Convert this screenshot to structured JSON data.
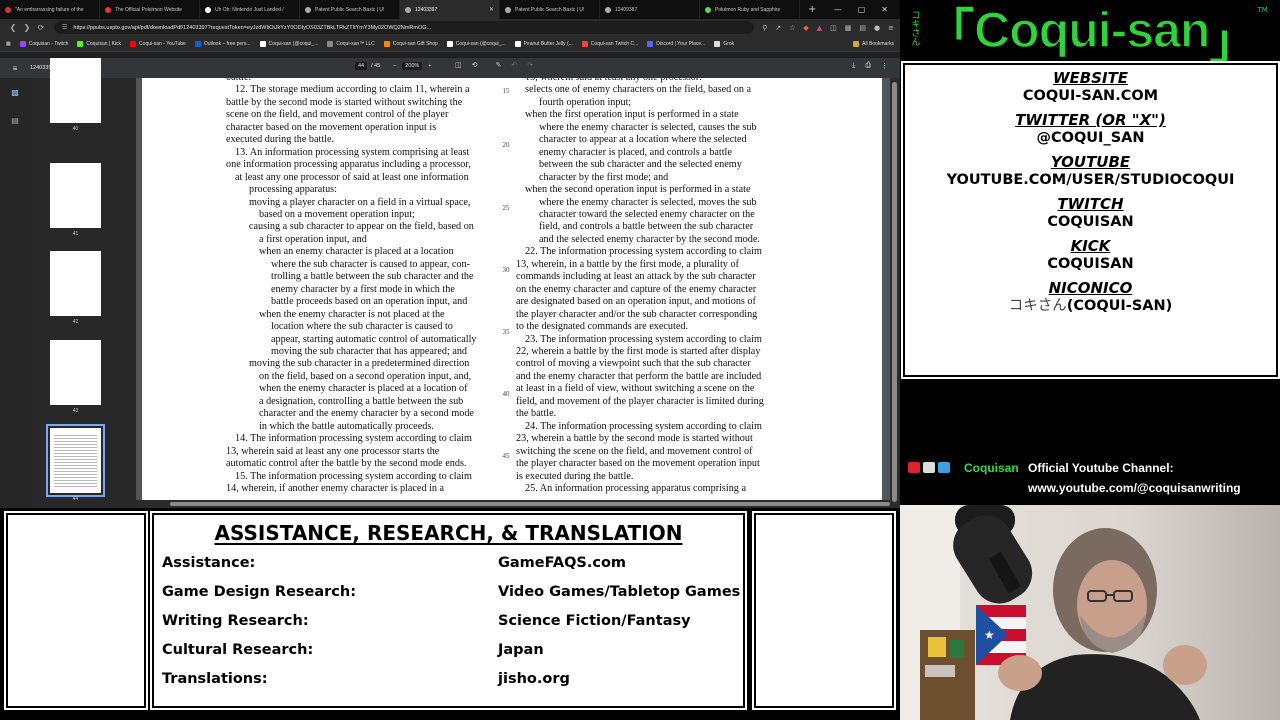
{
  "browser": {
    "tabs": [
      {
        "label": "\"An embarrassing failure of the",
        "color": "#d33"
      },
      {
        "label": "The Official Pokémon Website",
        "color": "#e33"
      },
      {
        "label": "Uh Oh: Nintendo Just Landed /",
        "color": "#fff"
      },
      {
        "label": "Patent Public Search Basic | U!",
        "color": "#aaa"
      },
      {
        "label": "12403397",
        "color": "#aaa",
        "active": true
      },
      {
        "label": "Patent Public Search Basic | U!",
        "color": "#aaa"
      },
      {
        "label": "12409387",
        "color": "#aaa"
      },
      {
        "label": "Pokémon Ruby and Sapphire",
        "color": "#6c6"
      }
    ],
    "url": "https://ppubs.uspto.gov/api/pdf/downloadPdf/12403397?requestToken=eyJzdWIiOiJkYzY0ODIyOS03ZTBkLTRkZTItYmY3My02OWQ2NmRmOG...",
    "bookmarks": [
      {
        "label": "Coquisan - Twitch",
        "color": "#9146ff"
      },
      {
        "label": "Coquisan | Kick",
        "color": "#53fc18"
      },
      {
        "label": "Coqui-san - YouTube",
        "color": "#f00"
      },
      {
        "label": "Outlook – free pers...",
        "color": "#0a64d8"
      },
      {
        "label": "Coqui-san (@coqui_...",
        "color": "#fff"
      },
      {
        "label": "Coqui-san™ LLC",
        "color": "#888"
      },
      {
        "label": "Coqui-san Gift Shop",
        "color": "#f80"
      },
      {
        "label": "Coqui-san (@coqui_...",
        "color": "#fff"
      },
      {
        "label": "Peanut Butter Jelly (...",
        "color": "#fff"
      },
      {
        "label": "Coqui-san Twitch C...",
        "color": "#e44"
      },
      {
        "label": "Discord | Your Place...",
        "color": "#5865f2"
      },
      {
        "label": "Grok",
        "color": "#ddd"
      }
    ],
    "all_bookmarks": "All Bookmarks"
  },
  "pdf": {
    "title": "12403397",
    "page_current": "44",
    "page_total": "/ 45",
    "zoom": "200%",
    "thumbnails": [
      "40",
      "41",
      "42",
      "43",
      "44"
    ],
    "left_column": [
      {
        "t": "battle.",
        "c": ""
      },
      {
        "t": "12. The storage medium according to claim 11, wherein a",
        "c": "i1"
      },
      {
        "t": "battle by the second mode is started without switching the",
        "c": ""
      },
      {
        "t": "scene on the field, and movement control of the player",
        "c": ""
      },
      {
        "t": "character based on the movement operation input is",
        "c": ""
      },
      {
        "t": "executed during the battle.",
        "c": ""
      },
      {
        "t": "13. An information processing system comprising at least",
        "c": "i1"
      },
      {
        "t": "one information processing apparatus including a processor,",
        "c": ""
      },
      {
        "t": "at least any one processor of said at least one information",
        "c": "i1"
      },
      {
        "t": "processing apparatus:",
        "c": "i3"
      },
      {
        "t": "moving a player character on a field in a virtual space,",
        "c": "i3"
      },
      {
        "t": "based on a movement operation input;",
        "c": "i4"
      },
      {
        "t": "causing a sub character to appear on the field, based on",
        "c": "i3"
      },
      {
        "t": "a first operation input, and",
        "c": "i4"
      },
      {
        "t": "when an enemy character is placed at a location",
        "c": "i4"
      },
      {
        "t": "where the sub character is caused to appear, con-",
        "c": "i5"
      },
      {
        "t": "trolling a battle between the sub character and the",
        "c": "i5"
      },
      {
        "t": "enemy character by a first mode in which the",
        "c": "i5"
      },
      {
        "t": "battle proceeds based on an operation input, and",
        "c": "i5"
      },
      {
        "t": "when the enemy character is not placed at the",
        "c": "i4"
      },
      {
        "t": "location where the sub character is caused to",
        "c": "i5"
      },
      {
        "t": "appear, starting automatic control of automatically",
        "c": "i5"
      },
      {
        "t": "moving the sub character that has appeared; and",
        "c": "i5"
      },
      {
        "t": "moving the sub character in a predetermined direction",
        "c": "i3"
      },
      {
        "t": "on the field, based on a second operation input, and,",
        "c": "i4"
      },
      {
        "t": "when the enemy character is placed at a location of",
        "c": "i4"
      },
      {
        "t": "a designation, controlling a battle between the sub",
        "c": "i4"
      },
      {
        "t": "character and the enemy character by a second mode",
        "c": "i4"
      },
      {
        "t": "in which the battle automatically proceeds.",
        "c": "i4"
      },
      {
        "t": "14. The information processing system according to claim",
        "c": "i1"
      },
      {
        "t": "13, wherein said at least any one processor starts the",
        "c": ""
      },
      {
        "t": "automatic control after the battle by the second mode ends.",
        "c": ""
      },
      {
        "t": "15. The information processing system according to claim",
        "c": "i1"
      },
      {
        "t": "14, wherein, if another enemy character is placed in a",
        "c": ""
      }
    ],
    "right_column": [
      {
        "t": "13, wherein said at least any one processor:",
        "c": "i1"
      },
      {
        "t": "selects one of enemy characters on the field, based on a",
        "c": "i1"
      },
      {
        "t": "fourth operation input;",
        "c": "i3"
      },
      {
        "t": "when the first operation input is performed in a state",
        "c": "i1"
      },
      {
        "t": "where the enemy character is selected, causes the sub",
        "c": "i3"
      },
      {
        "t": "character to appear at a location where the selected",
        "c": "i3"
      },
      {
        "t": "enemy character is placed, and controls a battle",
        "c": "i3"
      },
      {
        "t": "between the sub character and the selected enemy",
        "c": "i3"
      },
      {
        "t": "character by the first mode; and",
        "c": "i3"
      },
      {
        "t": "when the second operation input is performed in a state",
        "c": "i1"
      },
      {
        "t": "where the enemy character is selected, moves the sub",
        "c": "i3"
      },
      {
        "t": "character toward the selected enemy character on the",
        "c": "i3"
      },
      {
        "t": "field, and controls a battle between the sub character",
        "c": "i3"
      },
      {
        "t": "and the selected enemy character by the second mode.",
        "c": "i3"
      },
      {
        "t": "22. The information processing system according to claim",
        "c": "i1"
      },
      {
        "t": "13, wherein, in a battle by the first mode, a plurality of",
        "c": ""
      },
      {
        "t": "commands including at least an attack by the sub character",
        "c": ""
      },
      {
        "t": "on the enemy character and capture of the enemy character",
        "c": ""
      },
      {
        "t": "are designated based on an operation input, and motions of",
        "c": ""
      },
      {
        "t": "the player character and/or the sub character corresponding",
        "c": ""
      },
      {
        "t": "to the designated commands are executed.",
        "c": ""
      },
      {
        "t": "23. The information processing system according to claim",
        "c": "i1"
      },
      {
        "t": "22, wherein a battle by the first mode is started after display",
        "c": ""
      },
      {
        "t": "control of moving a viewpoint such that the sub character",
        "c": ""
      },
      {
        "t": "and the enemy character that perform the battle are included",
        "c": ""
      },
      {
        "t": "at least in a field of view, without switching a scene on the",
        "c": ""
      },
      {
        "t": "field, and movement of the player character is limited during",
        "c": ""
      },
      {
        "t": "the battle.",
        "c": ""
      },
      {
        "t": "24. The information processing system according to claim",
        "c": "i1"
      },
      {
        "t": "23, wherein a battle by the second mode is started without",
        "c": ""
      },
      {
        "t": "switching the scene on the field, and movement control of",
        "c": ""
      },
      {
        "t": "the player character based on the movement operation input",
        "c": ""
      },
      {
        "t": "is executed during the battle.",
        "c": ""
      },
      {
        "t": "25. An information processing apparatus comprising a",
        "c": "i1"
      }
    ],
    "line_numbers": [
      "15",
      "20",
      "25",
      "30",
      "35",
      "40",
      "45"
    ]
  },
  "logo": {
    "kana": "コキさん",
    "text": "Coqui-san",
    "tm": "TM",
    "color": "#2fd43a"
  },
  "socials": [
    {
      "label": "WEBSITE",
      "value": "COQUI-SAN.COM"
    },
    {
      "label": "TWITTER (OR \"X\")",
      "value": "@COQUI_SAN"
    },
    {
      "label": "YOUTUBE",
      "value": "YOUTUBE.COM/USER/STUDIOCOQUI"
    },
    {
      "label": "TWITCH",
      "value": "COQUISAN"
    },
    {
      "label": "KICK",
      "value": "COQUISAN"
    },
    {
      "label": "NICONICO",
      "value_kana": "コキさん",
      "value": "(COQUI-SAN)"
    }
  ],
  "channel": {
    "name": "Coquisan",
    "title": "Official Youtube Channel:",
    "url": "www.youtube.com/@coquisanwriting"
  },
  "credits": {
    "title": "ASSISTANCE, RESEARCH, & TRANSLATION",
    "rows": [
      {
        "label": "Assistance:",
        "value": "GameFAQS.com"
      },
      {
        "label": "Game Design Research:",
        "value": "Video Games/Tabletop Games"
      },
      {
        "label": "Writing Research:",
        "value": "Science Fiction/Fantasy"
      },
      {
        "label": "Cultural Research:",
        "value": "Japan"
      },
      {
        "label": "Translations:",
        "value": "jisho.org"
      }
    ]
  }
}
